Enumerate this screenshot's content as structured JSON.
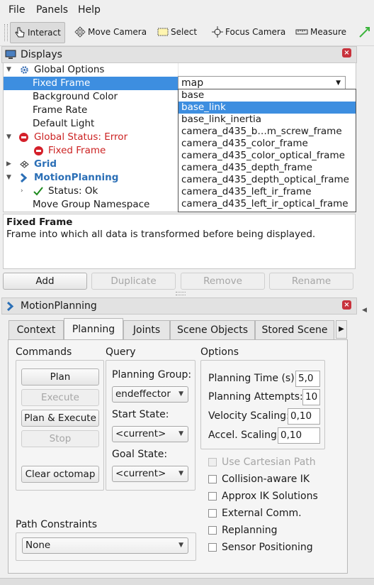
{
  "menubar": {
    "file": "File",
    "panels": "Panels",
    "help": "Help"
  },
  "toolbar": {
    "interact": "Interact",
    "move_camera": "Move Camera",
    "select": "Select",
    "focus_camera": "Focus Camera",
    "measure": "Measure"
  },
  "displays": {
    "title": "Displays",
    "rows": {
      "global_options": "Global Options",
      "fixed_frame": "Fixed Frame",
      "background_color": "Background Color",
      "frame_rate": "Frame Rate",
      "default_light": "Default Light",
      "global_status": "Global Status: Error",
      "fixed_frame_err": "Fixed Frame",
      "grid": "Grid",
      "motion_planning": "MotionPlanning",
      "status_ok": "Status: Ok",
      "move_group_ns": "Move Group Namespace"
    },
    "fixed_frame_value": "map",
    "dropdown_options": [
      "base",
      "base_link",
      "base_link_inertia",
      "camera_d435_b…m_screw_frame",
      "camera_d435_color_frame",
      "camera_d435_color_optical_frame",
      "camera_d435_depth_frame",
      "camera_d435_depth_optical_frame",
      "camera_d435_left_ir_frame",
      "camera_d435_left_ir_optical_frame"
    ],
    "selected_option": "base_link",
    "description_title": "Fixed Frame",
    "description_text": "Frame into which all data is transformed before being displayed.",
    "buttons": {
      "add": "Add",
      "duplicate": "Duplicate",
      "remove": "Remove",
      "rename": "Rename"
    }
  },
  "motion_planning": {
    "title": "MotionPlanning",
    "tabs": [
      "Context",
      "Planning",
      "Joints",
      "Scene Objects",
      "Stored Scene"
    ],
    "active_tab": "Planning",
    "commands": {
      "title": "Commands",
      "plan": "Plan",
      "execute": "Execute",
      "plan_execute": "Plan & Execute",
      "stop": "Stop",
      "clear_octomap": "Clear octomap"
    },
    "query": {
      "title": "Query",
      "planning_group_label": "Planning Group:",
      "planning_group_value": "endeffector",
      "start_state_label": "Start State:",
      "start_state_value": "<current>",
      "goal_state_label": "Goal State:",
      "goal_state_value": "<current>"
    },
    "options": {
      "title": "Options",
      "planning_time_label": "Planning Time (s):",
      "planning_time_value": "5,0",
      "planning_attempts_label": "Planning Attempts:",
      "planning_attempts_value": "10",
      "velocity_scaling_label": "Velocity Scaling:",
      "velocity_scaling_value": "0,10",
      "accel_scaling_label": "Accel. Scaling:",
      "accel_scaling_value": "0,10",
      "checkboxes": [
        "Use Cartesian Path",
        "Collision-aware IK",
        "Approx IK Solutions",
        "External Comm.",
        "Replanning",
        "Sensor Positioning"
      ]
    },
    "path_constraints": {
      "label": "Path Constraints",
      "value": "None"
    }
  }
}
